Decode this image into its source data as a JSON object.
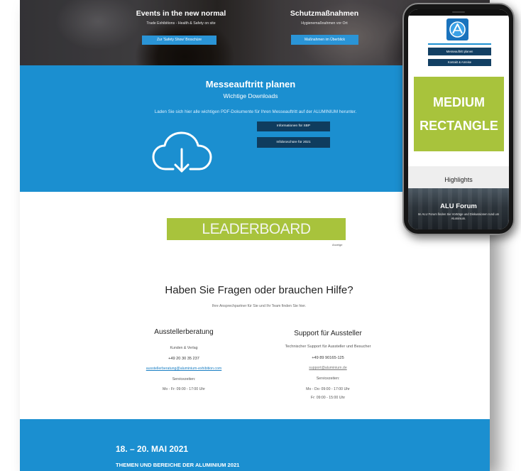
{
  "theme": {
    "primary_blue": "#1b8fd0",
    "navy_button": "#0f3c5e",
    "hero_button_blue": "#2a94d6",
    "ad_green": "#a8c33c",
    "link_blue": "#1a7fc4"
  },
  "desktop": {
    "hero": {
      "left": {
        "title": "Events in the new normal",
        "subtitle": "Trade Exhibitions - Health & Safety on site",
        "button_label": "Zur 'Safety Show' Broschüre"
      },
      "right": {
        "title": "Schutzmaßnahmen",
        "subtitle": "Hygienemaßnahmen vor Ort",
        "button_label": "Maßnahmen im Überblick"
      }
    },
    "downloads": {
      "title": "Messeauftritt planen",
      "subtitle": "Wichtige Downloads",
      "description": "Laden Sie sich hier alle wichtigen PDF-Dokumente für Ihren Messeauftritt auf der ALUMINIUM herunter.",
      "icon": "cloud-download-icon",
      "buttons": [
        {
          "label": "Informationen für SBP"
        },
        {
          "label": "Infobroschüre für 2021"
        }
      ]
    },
    "leaderboard": {
      "label": "LEADERBOARD",
      "ad_note": "Anzeige"
    },
    "help": {
      "title": "Haben Sie Fragen oder brauchen Hilfe?",
      "subtitle": "Ihre Ansprechpartner für Sie und Ihr Team finden Sie hier.",
      "columns": [
        {
          "title": "Ausstellerberatung",
          "contact": "Kunden & Verlag",
          "phone": "+49 20 30 35 237",
          "email": "ausstellerberatung@aluminium-exhibition.com",
          "hours_label": "Servicezeiten:",
          "hours": [
            "Mo - Fr: 09:00 - 17:00 Uhr"
          ]
        },
        {
          "title": "Support für Aussteller",
          "contact": "Technischer Support für Aussteller und Besucher",
          "phone": "+49 89 90165-125",
          "email": "support@aluminium.de",
          "hours_label": "Servicezeiten:",
          "hours": [
            "Mo - Do: 09:00 - 17:00 Uhr",
            "Fr: 09:00 - 15:00 Uhr"
          ]
        }
      ]
    },
    "event_banner": {
      "dates": "18. – 20. MAI 2021",
      "subtitle": "THEMEN UND BEREICHE DER ALUMINIUM 2021"
    }
  },
  "mobile": {
    "logo_icon": "alu-logo",
    "nav_buttons": [
      {
        "label": "Messeauftritt planen"
      },
      {
        "label": "Kontakt & Anreise"
      }
    ],
    "medium_rectangle": {
      "line1": "MEDIUM",
      "line2": "RECTANGLE"
    },
    "highlights": {
      "title": "Highlights",
      "card": {
        "title": "ALU Forum",
        "text": "Im ALU Forum finden Sie Vorträge und Diskussionen rund um Aluminium."
      }
    }
  }
}
